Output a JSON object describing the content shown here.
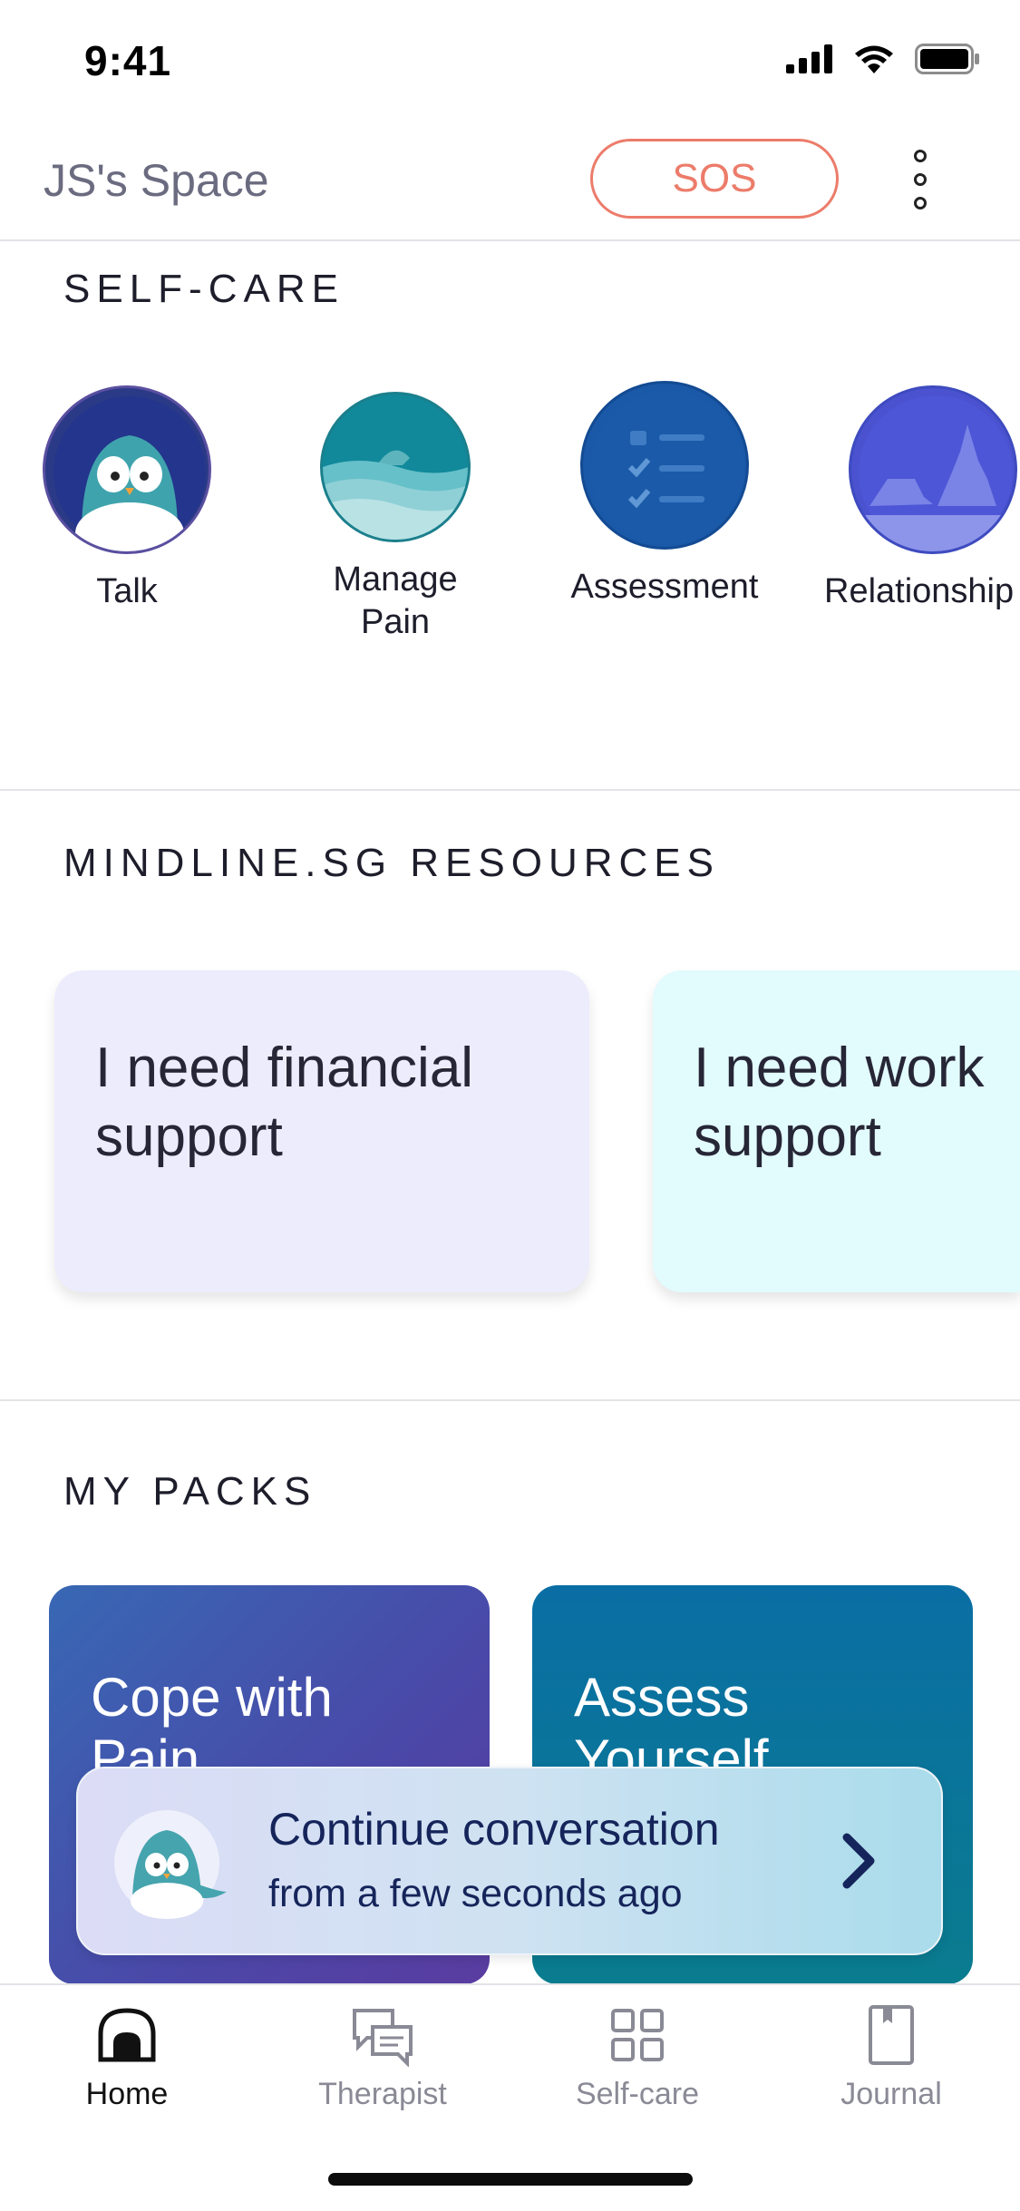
{
  "status_bar": {
    "time": "9:41"
  },
  "header": {
    "title": "JS's Space",
    "sos_label": "SOS"
  },
  "self_care": {
    "title": "SELF-CARE",
    "items": [
      {
        "label": "Talk",
        "icon": "penguin-icon"
      },
      {
        "label": "Manage Pain",
        "icon": "shark-waves-icon"
      },
      {
        "label": "Assessment",
        "icon": "checklist-icon"
      },
      {
        "label": "Relationship",
        "icon": "wolves-icon"
      }
    ]
  },
  "resources": {
    "title": "MINDLINE.SG RESOURCES",
    "cards": [
      {
        "text": "I need financial support",
        "color": "#ececfd"
      },
      {
        "text": "I need work support",
        "color": "#e2fbfd"
      }
    ]
  },
  "packs": {
    "title": "MY PACKS",
    "cards": [
      {
        "title": "Cope with Pain"
      },
      {
        "title": "Assess Yourself"
      }
    ]
  },
  "continue_banner": {
    "title": "Continue conversation",
    "subtitle": "from a few seconds ago"
  },
  "tabbar": {
    "tabs": [
      {
        "label": "Home",
        "icon": "home-icon",
        "active": true
      },
      {
        "label": "Therapist",
        "icon": "chat-bubbles-icon",
        "active": false
      },
      {
        "label": "Self-care",
        "icon": "grid-icon",
        "active": false
      },
      {
        "label": "Journal",
        "icon": "journal-icon",
        "active": false
      }
    ]
  },
  "colors": {
    "accent_sos": "#ec7c6a",
    "banner_text": "#15245a",
    "pack_blue": "#3b56b0",
    "pack_teal": "#0a6f9e"
  }
}
